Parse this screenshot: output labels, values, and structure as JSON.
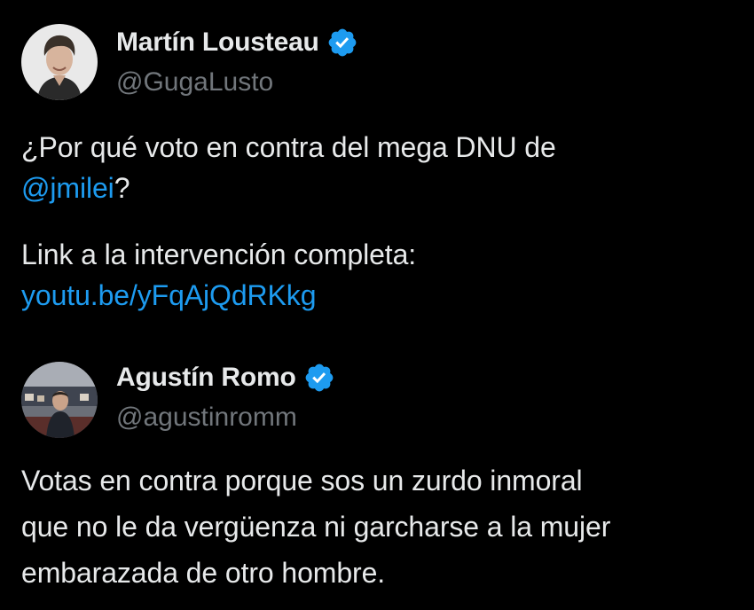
{
  "colors": {
    "background": "#000000",
    "text": "#e7e9ea",
    "secondary": "#71767b",
    "link": "#1d9bf0",
    "verified": "#1d9bf0"
  },
  "tweets": [
    {
      "author": {
        "name": "Martín Lousteau",
        "handle": "@GugaLusto",
        "verified_icon": "verified-badge-icon"
      },
      "text": {
        "line1": "¿Por qué voto en contra del mega DNU de",
        "mention": "@jmilei",
        "after_mention": "?",
        "line3": "Link a la intervención completa:",
        "link": "youtu.be/yFqAjQdRKkg"
      }
    },
    {
      "author": {
        "name": "Agustín Romo",
        "handle": "@agustinromm",
        "verified_icon": "verified-badge-icon"
      },
      "text": {
        "line1": "Votas en contra porque sos un zurdo inmoral",
        "line2": "que no le da vergüenza ni garcharse a la mujer",
        "line3": "embarazada de otro hombre."
      }
    }
  ]
}
